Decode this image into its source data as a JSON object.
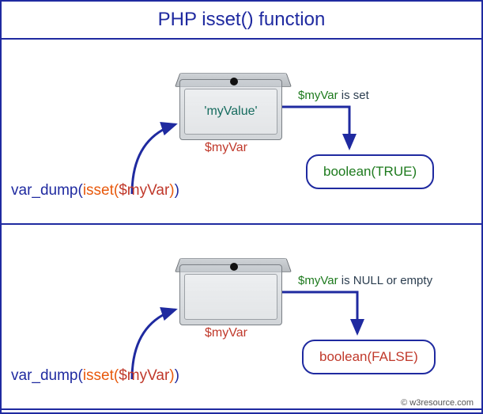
{
  "title": "PHP isset() function",
  "panels": [
    {
      "code": {
        "fn": "var_dump",
        "p1": "(",
        "inner_fn": "isset",
        "p2": "(",
        "arg": "$myVar",
        "p3": ")",
        "p4": ")"
      },
      "box_value": "'myValue'",
      "var_name": "$myVar",
      "status_var": "$myVar",
      "status_text": "is set",
      "result": "boolean(TRUE)",
      "result_color": "#1d7a1d"
    },
    {
      "code": {
        "fn": "var_dump",
        "p1": "(",
        "inner_fn": "isset",
        "p2": "(",
        "arg": "$myVar",
        "p3": ")",
        "p4": ")"
      },
      "box_value": "",
      "var_name": "$myVar",
      "status_var": "$myVar",
      "status_text": "is NULL or empty",
      "result": "boolean(FALSE)",
      "result_color": "#c0392b"
    }
  ],
  "credit": "© w3resource.com"
}
